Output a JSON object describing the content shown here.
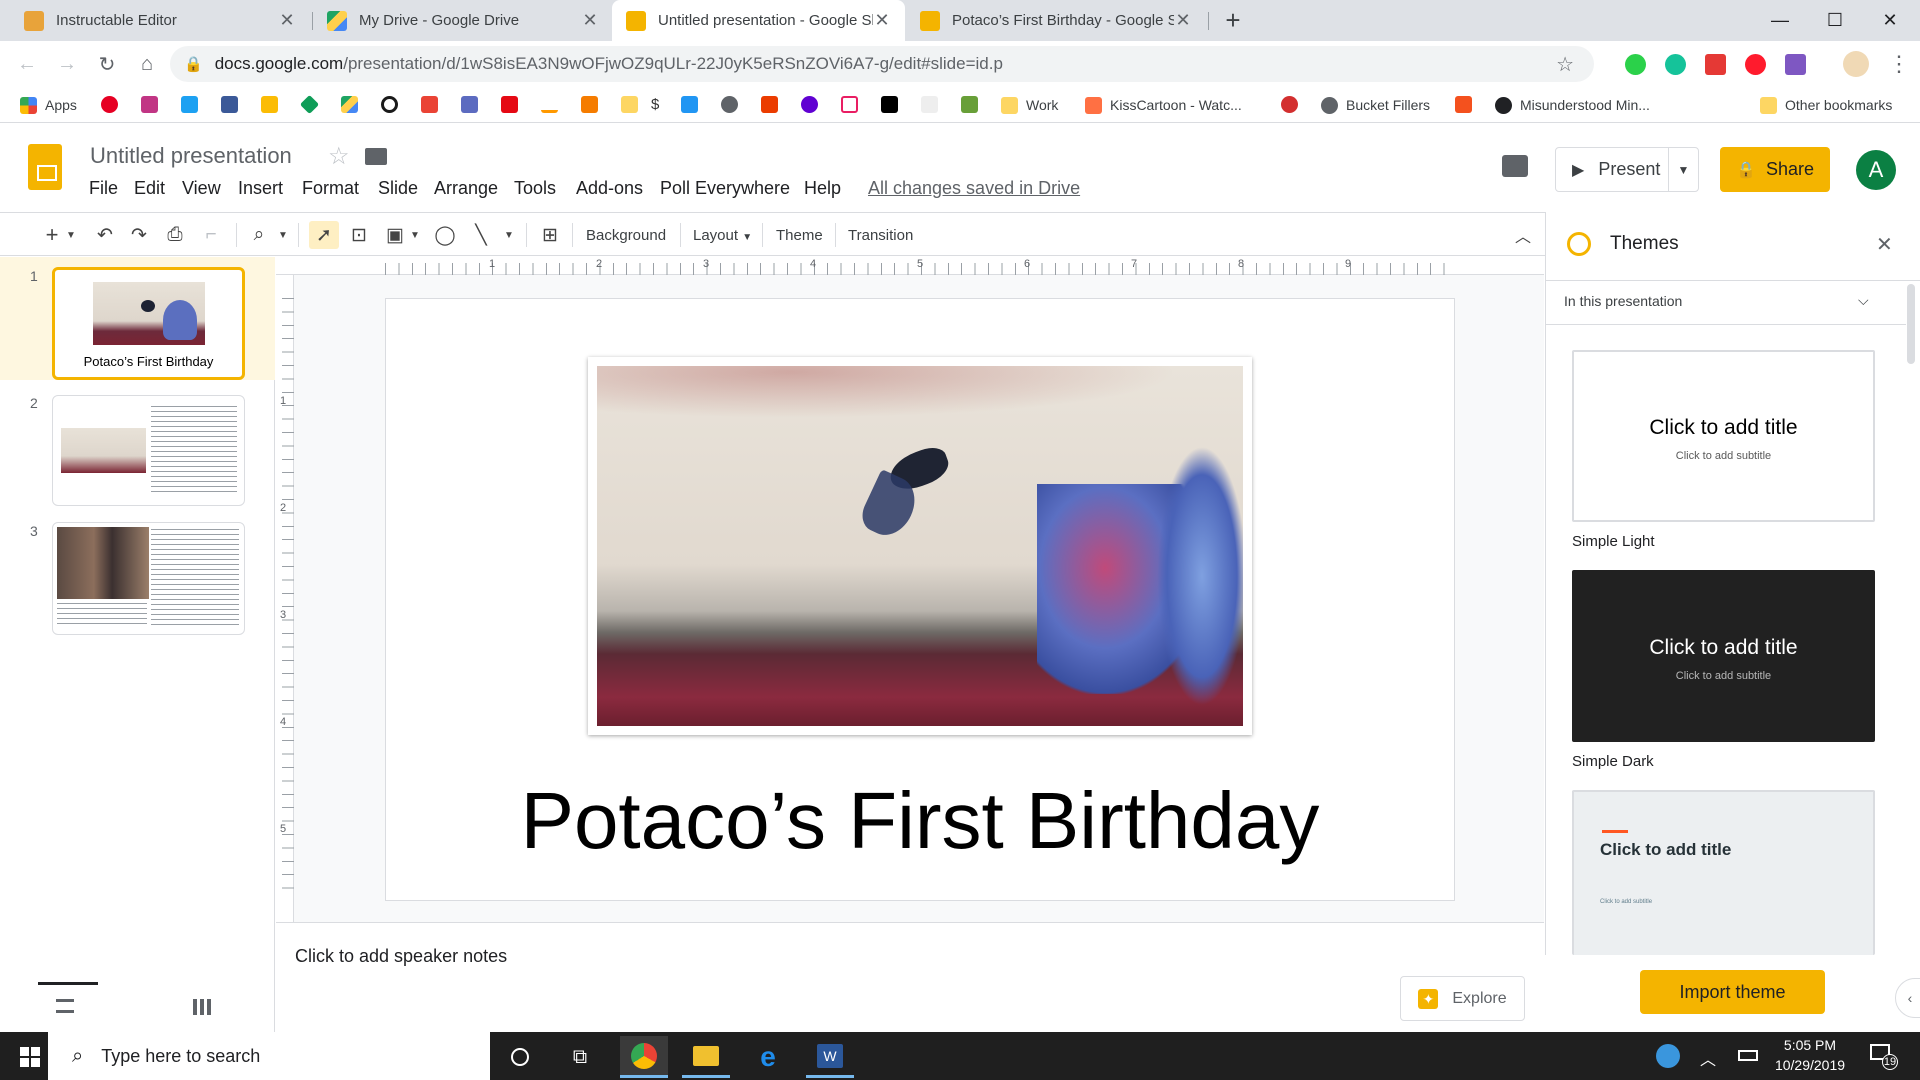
{
  "tabs": [
    {
      "title": "Instructable Editor",
      "color": "#e8a33a"
    },
    {
      "title": "My Drive - Google Drive",
      "color": "#1fa463"
    },
    {
      "title": "Untitled presentation - Google Sl",
      "color": "#f4b400",
      "active": true
    },
    {
      "title": "Potaco’s First Birthday - Google S",
      "color": "#f4b400"
    }
  ],
  "window": {
    "new_tab": "+",
    "minimize": "—",
    "maximize": "☐",
    "close": "✕"
  },
  "address": {
    "domain": "docs.google.com",
    "path": "/presentation/d/1wS8isEA3N9wOFjwOZ9qULr-22J0yK5eRSnZOVi6A7-g/edit#slide=id.p"
  },
  "bookmarks": {
    "apps": "Apps",
    "work": "Work",
    "kisscartoon": "KissCartoon - Watc...",
    "bucket": "Bucket Fillers",
    "misunderstood": "Misunderstood Min...",
    "other": "Other bookmarks"
  },
  "header": {
    "title": "Untitled presentation",
    "menus": [
      "File",
      "Edit",
      "View",
      "Insert",
      "Format",
      "Slide",
      "Arrange",
      "Tools",
      "Add-ons",
      "Poll Everywhere",
      "Help"
    ],
    "saved": "All changes saved in Drive",
    "present": "Present",
    "share": "Share",
    "avatar": "A"
  },
  "toolbar": {
    "background": "Background",
    "layout": "Layout",
    "theme": "Theme",
    "transition": "Transition"
  },
  "ruler": {
    "h": [
      "1",
      "2",
      "3",
      "4",
      "5",
      "6",
      "7",
      "8",
      "9"
    ],
    "v": [
      "1",
      "2",
      "3",
      "4",
      "5"
    ]
  },
  "filmstrip": {
    "nums": [
      "1",
      "2",
      "3"
    ],
    "slide1_caption": "Potaco’s First Birthday"
  },
  "slide": {
    "title": "Potaco’s First Birthday"
  },
  "notes": {
    "placeholder": "Click to add speaker notes"
  },
  "explore": "Explore",
  "themes": {
    "title": "Themes",
    "filter": "In this presentation",
    "cards": [
      {
        "name": "Simple Light",
        "title": "Click to add title",
        "subtitle": "Click to add subtitle"
      },
      {
        "name": "Simple Dark",
        "title": "Click to add title",
        "subtitle": "Click to add subtitle"
      },
      {
        "name": "",
        "title": "Click to add title",
        "subtitle": "Click to add subtitle"
      }
    ],
    "import": "Import theme"
  },
  "taskbar": {
    "search": "Type here to search",
    "time": "5:05 PM",
    "date": "10/29/2019",
    "notifications": "19"
  }
}
